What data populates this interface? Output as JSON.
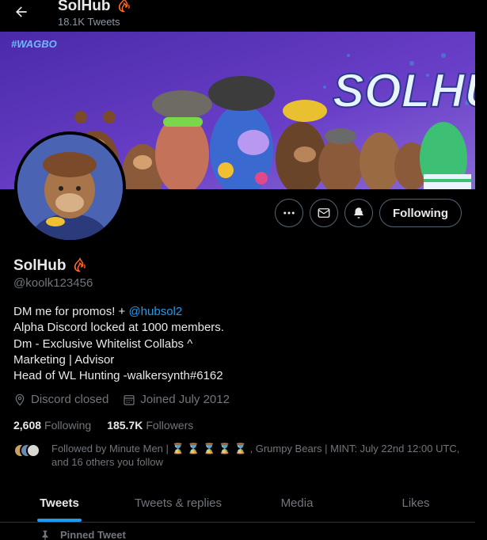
{
  "header": {
    "name": "SolHub",
    "tweet_count": "18.1K Tweets"
  },
  "banner": {
    "hashtag": "#WAGBO",
    "brand": "SOLHUB",
    "colors": {
      "sky": "#5a3ac0",
      "accent_text": "#e9f4ff"
    }
  },
  "profile": {
    "name": "SolHub",
    "handle": "@koolk123456",
    "bio": {
      "line1_prefix": "DM me for promos! + ",
      "line1_link": "@hubsol2",
      "line2": "Alpha Discord locked at 1000 members.",
      "line3": "Dm - Exclusive Whitelist Collabs ^",
      "line4": "Marketing | Advisor",
      "line5": "Head of WL Hunting -walkersynth#6162"
    },
    "location": "Discord closed",
    "joined": "Joined July 2012",
    "following_count": "2,608",
    "following_label": "Following",
    "followers_count": "185.7K",
    "followers_label": "Followers",
    "followed_by": "Followed by Minute Men | ⌛ ⌛ ⌛ ⌛ ⌛ , Grumpy Bears | MINT: July 22nd 12:00 UTC, and 16 others you follow"
  },
  "actions": {
    "more_icon": "more-icon",
    "message_icon": "envelope-icon",
    "notify_icon": "bell-icon",
    "follow_label": "Following"
  },
  "tabs": [
    {
      "label": "Tweets",
      "active": true
    },
    {
      "label": "Tweets & replies",
      "active": false
    },
    {
      "label": "Media",
      "active": false
    },
    {
      "label": "Likes",
      "active": false
    }
  ],
  "pinned": {
    "label": "Pinned Tweet"
  },
  "colors": {
    "accent": "#1d9bf0",
    "background": "#000000",
    "muted_text": "#71767b",
    "border": "#536471"
  }
}
